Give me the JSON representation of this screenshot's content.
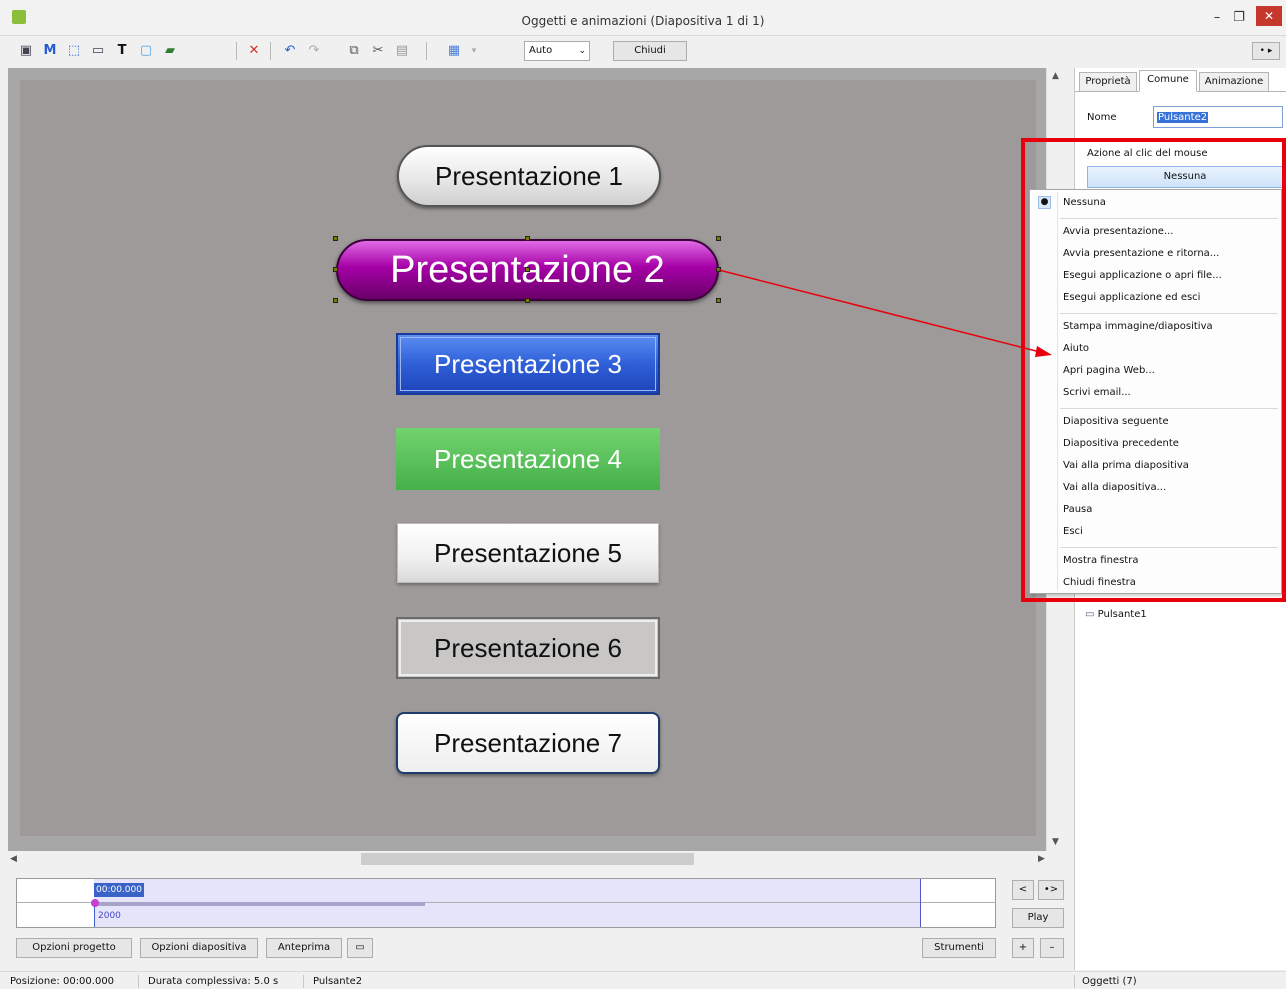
{
  "window": {
    "title": "Oggetti e animazioni  (Diapositiva 1 di 1)",
    "minimize": "–",
    "maximize": "❐",
    "close": "✕"
  },
  "toolbar": {
    "zoom": "Auto",
    "close_label": "Chiudi",
    "right_button": "• ▸"
  },
  "slide": {
    "buttons": [
      "Presentazione 1",
      "Presentazione 2",
      "Presentazione 3",
      "Presentazione 4",
      "Presentazione 5",
      "Presentazione 6",
      "Presentazione 7"
    ]
  },
  "timeline": {
    "time": "00:00.000",
    "value": "2000"
  },
  "side_controls": {
    "prev": "<",
    "next": "•>",
    "play": "Play",
    "add": "+",
    "remove": "–"
  },
  "bottom": {
    "project_options": "Opzioni progetto",
    "slide_options": "Opzioni diapositiva",
    "preview": "Anteprima",
    "tools": "Strumenti"
  },
  "status": {
    "position": "Posizione:  00:00.000",
    "duration": "Durata complessiva:  5.0 s",
    "object": "Pulsante2"
  },
  "panel": {
    "tabs": [
      "Proprietà",
      "Comune",
      "Animazione"
    ],
    "name_label": "Nome",
    "name_value": "Pulsante2",
    "action_label": "Azione al clic del mouse",
    "action_value": "Nessuna",
    "list_item": "Pulsante1",
    "objects_count": "Oggetti (7)"
  },
  "menu": {
    "items": [
      "Nessuna",
      "Avvia presentazione...",
      "Avvia presentazione e ritorna...",
      "Esegui applicazione o apri file...",
      "Esegui applicazione ed esci",
      "Stampa immagine/diapositiva",
      "Aiuto",
      "Apri pagina Web...",
      "Scrivi email...",
      "Diapositiva seguente",
      "Diapositiva precedente",
      "Vai alla prima diapositiva",
      "Vai alla diapositiva...",
      "Pausa",
      "Esci",
      "Mostra finestra",
      "Chiudi finestra"
    ]
  },
  "colors": {
    "highlight": "#e8000d",
    "arrow": "#e8000d",
    "selected_button": "#a500a5"
  }
}
